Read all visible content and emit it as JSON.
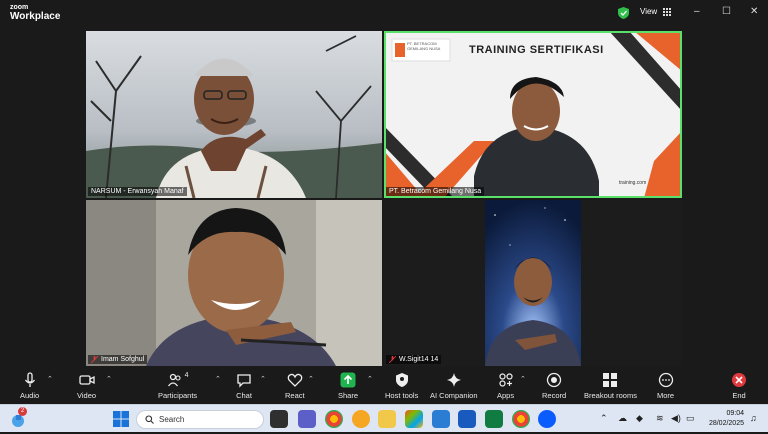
{
  "app": {
    "brand_small": "zoom",
    "brand_large": "Workplace",
    "view_label": "View"
  },
  "window_controls": {
    "minimize": "–",
    "maximize": "☐",
    "close": "✕"
  },
  "participants": [
    {
      "name": "NARSUM - Erwansyah Manaf",
      "muted": false
    },
    {
      "name": "PT. Betracom Gemilang Nusa",
      "muted": false,
      "slide_title": "TRAINING SERTIFIKASI",
      "slide_brand": "PT. BETRACOM GEMILANG NUSA",
      "slide_url": "training.com"
    },
    {
      "name": "Imam Sofghul",
      "muted": true
    },
    {
      "name": "W.Sigit14 14",
      "muted": true
    }
  ],
  "toolbar": {
    "audio": "Audio",
    "video": "Video",
    "participants": "Participants",
    "participant_count": "4",
    "chat": "Chat",
    "react": "React",
    "share": "Share",
    "host_tools": "Host tools",
    "ai_companion": "AI Companion",
    "apps": "Apps",
    "record": "Record",
    "breakout_rooms": "Breakout rooms",
    "more": "More",
    "end": "End"
  },
  "taskbar": {
    "search_placeholder": "Search",
    "notification_count": "2",
    "time": "09:04",
    "date": "28/02/2025"
  },
  "colors": {
    "accent_green": "#5be06b",
    "share_green": "#21b34f",
    "end_red": "#e0393e"
  }
}
